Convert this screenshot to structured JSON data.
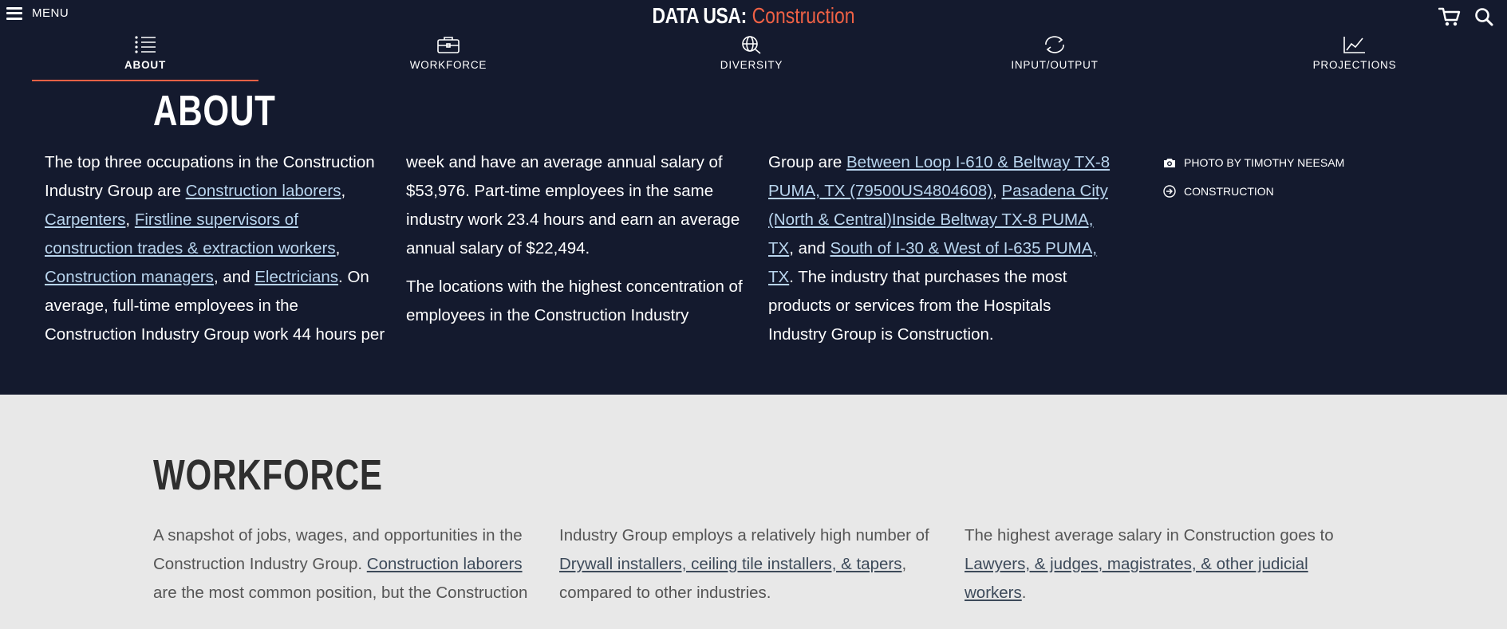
{
  "header": {
    "menu_label": "MENU",
    "logo_brand": "DATA USA",
    "logo_colon": ":",
    "logo_topic": "Construction",
    "accent_color": "#ef6145",
    "icons": [
      "cart-icon",
      "search-icon"
    ]
  },
  "section_nav": {
    "tabs": [
      {
        "label": "ABOUT",
        "icon": "list-icon",
        "active": true
      },
      {
        "label": "WORKFORCE",
        "icon": "briefcase-icon",
        "active": false
      },
      {
        "label": "DIVERSITY",
        "icon": "globe-search-icon",
        "active": false
      },
      {
        "label": "INPUT/OUTPUT",
        "icon": "cycle-icon",
        "active": false
      },
      {
        "label": "PROJECTIONS",
        "icon": "line-chart-icon",
        "active": false
      }
    ]
  },
  "about": {
    "title": "ABOUT",
    "col1": {
      "t1": "The top three occupations in the Construction Industry Group are ",
      "l1": "Construction laborers",
      "t2": ", ",
      "l2": "Carpenters",
      "t3": ", ",
      "l3": "Firstline supervisors of construction trades & extraction workers",
      "t4": ", ",
      "l4": "Construction managers",
      "t5": ", and ",
      "l5": "Electricians",
      "t6": ". On average, full-time employees in the Construction Industry Group work 44 hours per"
    },
    "col2": {
      "p1": "week and have an average annual salary of $53,976. Part-time employees in the same industry work 23.4 hours and earn an average annual salary of $22,494.",
      "p2": "The locations with the highest concentration of employees in the Construction Industry"
    },
    "col3": {
      "t1": "Group are ",
      "l1": "Between Loop I-610 & Beltway TX-8 PUMA, TX (79500US4804608)",
      "t2": ", ",
      "l2": "Pasadena City (North & Central)Inside Beltway TX-8 PUMA, TX",
      "t3": ", and ",
      "l3": "South of I-30 & West of I-635 PUMA, TX",
      "t4": ". The industry that purchases the most products or services from the Hospitals Industry Group is Construction."
    },
    "side_links": {
      "photo_credit": "PHOTO BY TIMOTHY NEESAM",
      "construction_link": "CONSTRUCTION"
    }
  },
  "workforce": {
    "title": "WORKFORCE",
    "col1": {
      "t1": "A snapshot of jobs, wages, and opportunities in the Construction Industry Group. ",
      "l1": "Construction laborers",
      "t2": " are the most common position, but the Construction"
    },
    "col2": {
      "t1": "Industry Group employs a relatively high number of ",
      "l1": "Drywall installers, ceiling tile installers, & tapers",
      "t2": ", compared to other industries."
    },
    "col3": {
      "t1": "The highest average salary in Construction goes to ",
      "l1": "Lawyers, & judges, magistrates, & other judicial workers",
      "t2": "."
    }
  }
}
